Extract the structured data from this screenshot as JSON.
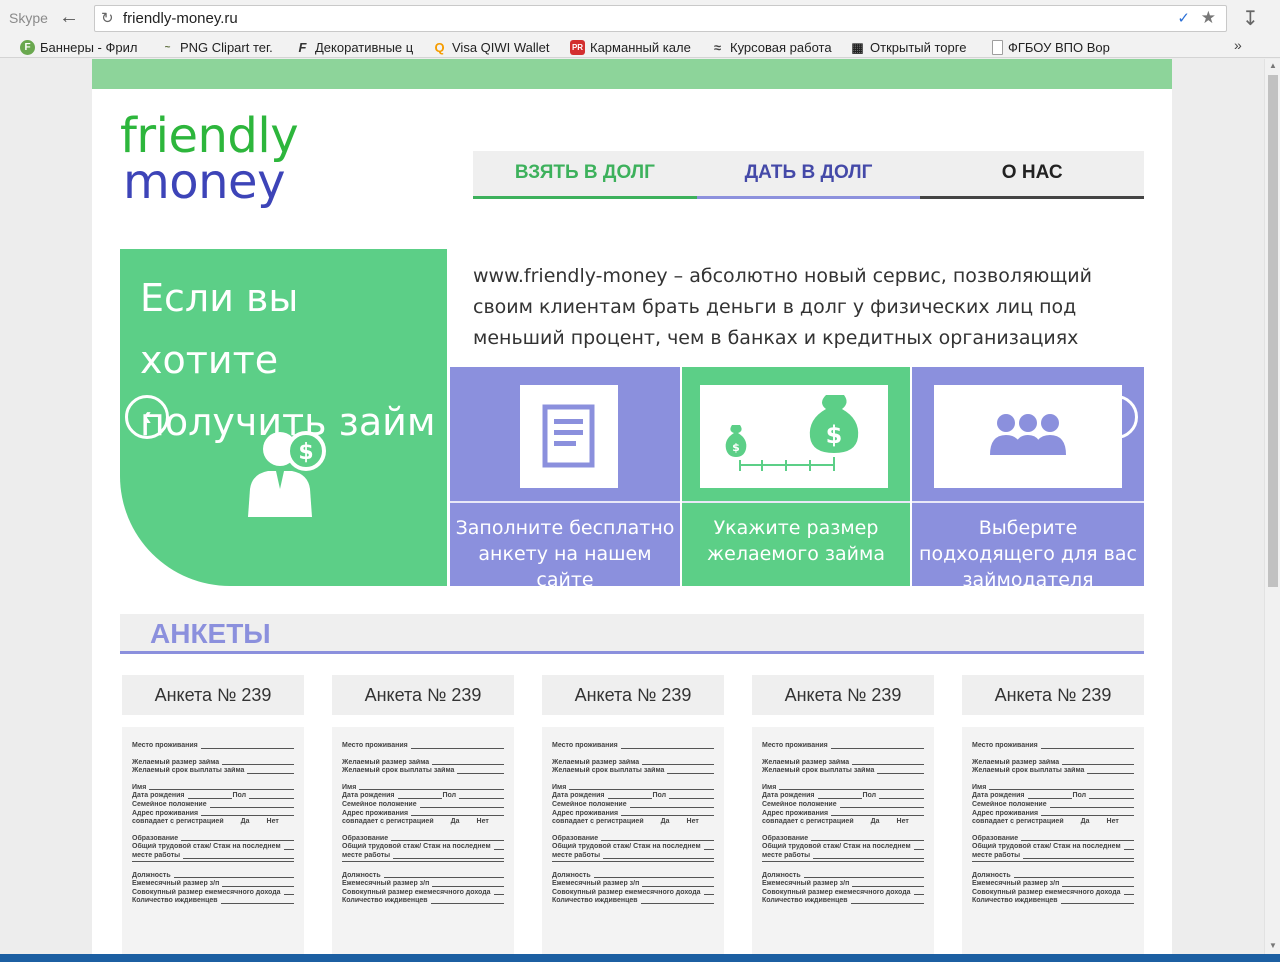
{
  "browser": {
    "skype_label": "Skype",
    "url": "friendly-money.ru",
    "bookmarks": [
      {
        "label": "Баннеры - Фрил",
        "color": "#6aa84f",
        "glyph": "F"
      },
      {
        "label": "PNG Clipart тег.",
        "color": "#5f6f3f",
        "glyph": "~"
      },
      {
        "label": "Декоративные ц",
        "color": "#333333",
        "glyph": "F"
      },
      {
        "label": "Visa QIWI Wallet",
        "color": "#f59c00",
        "glyph": "Q"
      },
      {
        "label": "Карманный кале",
        "color": "#d32f2f",
        "glyph": "PR"
      },
      {
        "label": "Курсовая работа",
        "color": "#444444",
        "glyph": "≈"
      },
      {
        "label": "Открытый торге",
        "color": "#222222",
        "glyph": "▦"
      },
      {
        "label": "ФГБОУ ВПО Вор",
        "color": "#9e9e9e",
        "glyph": ""
      }
    ],
    "more_label": "»"
  },
  "site": {
    "logo_line1": "friendly",
    "logo_line2": "money",
    "nav": {
      "take": "ВЗЯТЬ В ДОЛГ",
      "give": "ДАТЬ В ДОЛГ",
      "about": "О НАС"
    },
    "hero": {
      "heading": "Если вы хотите получить займ",
      "intro": "www.friendly-money – абсолютно новый сервис, позволяющий своим клиентам брать деньги в долг у физических лиц под меньший процент, чем в банках и кредитных организациях",
      "steps": [
        {
          "text": "Заполните бесплатно анкету на нашем сайте",
          "icon": "document-icon"
        },
        {
          "text": "Укажите размер желаемого займа",
          "icon": "money-bags-icon"
        },
        {
          "text": "Выберите подходящего для вас займодателя",
          "icon": "people-icon"
        }
      ]
    },
    "section_title": "АНКЕТЫ",
    "cards": [
      {
        "title": "Анкета № 239"
      },
      {
        "title": "Анкета № 239"
      },
      {
        "title": "Анкета № 239"
      },
      {
        "title": "Анкета № 239"
      },
      {
        "title": "Анкета № 239"
      }
    ],
    "form_labels": {
      "residence": "Место проживания",
      "amount": "Желаемый размер займа",
      "term": "Желаемый срок выплаты займа",
      "name": "Имя",
      "birth": "Дата рождения",
      "sex": "Пол",
      "family": "Семейное положение",
      "address": "Адрес проживания",
      "matches": "совпадает с регистрацией",
      "yes": "Да",
      "no": "Нет",
      "education": "Образование",
      "experience": "Общий трудовой стаж/ Стаж на последнем",
      "workplace": "месте работы",
      "position": "Должность",
      "salary": "Ежемесячный размер з/п",
      "income": "Совокупный размер ежемесячного дохода",
      "dependents": "Количество иждивенцев"
    }
  },
  "colors": {
    "green": "#5ccf87",
    "purple": "#8b90dd",
    "logo_green": "#2db63c",
    "logo_blue": "#3d44b8"
  }
}
